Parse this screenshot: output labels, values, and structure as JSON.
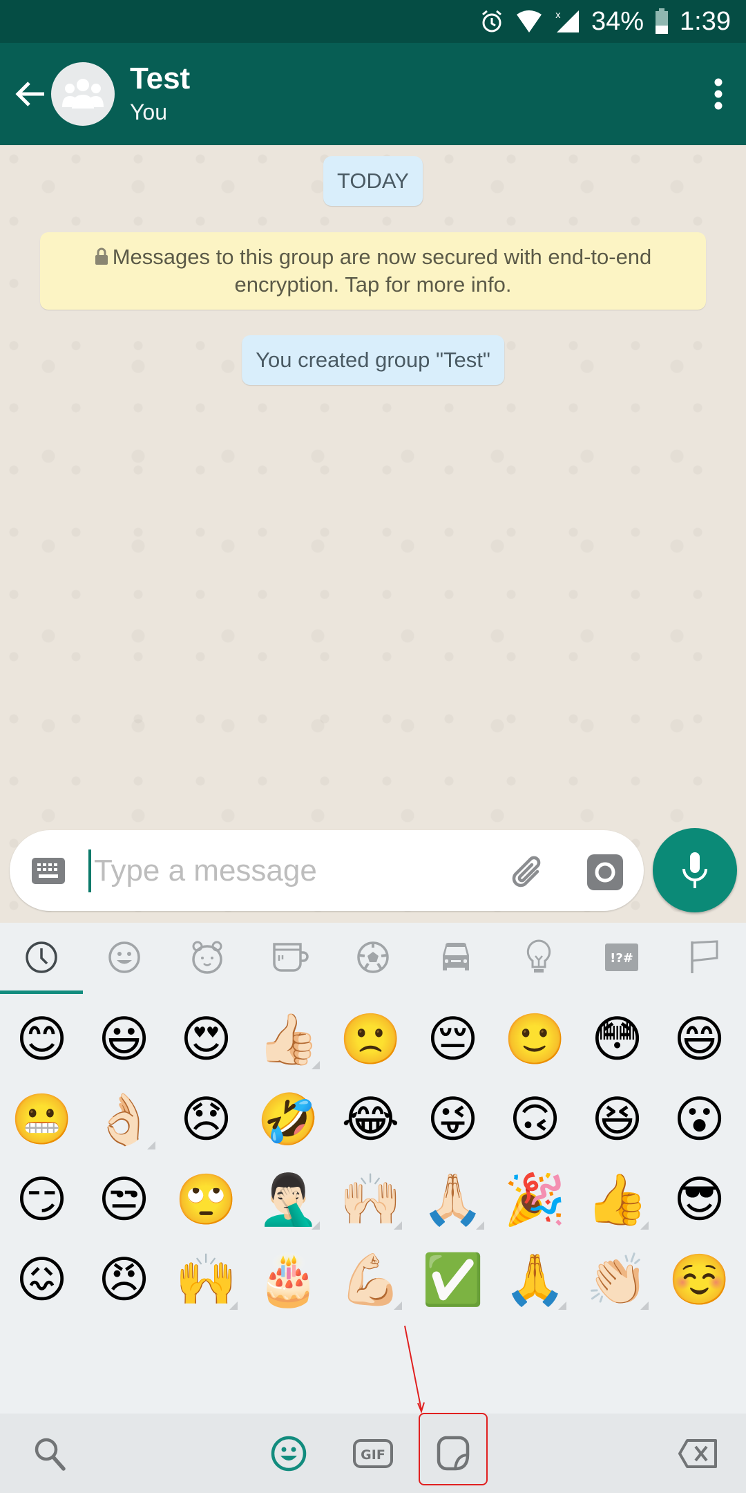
{
  "status_bar": {
    "icons": [
      "alarm-icon",
      "wifi-icon",
      "cell-signal-icon",
      "battery-icon"
    ],
    "battery": "34%",
    "time": "1:39"
  },
  "app_bar": {
    "back_icon": "arrow-left-icon",
    "avatar_icon": "group-icon",
    "title": "Test",
    "subtitle": "You",
    "menu_icon": "more-vertical-icon"
  },
  "chat": {
    "date_chip": "TODAY",
    "encryption_notice": "Messages to this group are now secured with end-to-end encryption. Tap for more info.",
    "system_message": "You created group \"Test\""
  },
  "composer": {
    "keyboard_icon": "keyboard-icon",
    "placeholder": "Type a message",
    "value": "",
    "attach_icon": "paperclip-icon",
    "camera_icon": "camera-icon",
    "mic_icon": "microphone-icon"
  },
  "emoji_panel": {
    "categories": [
      {
        "name": "recent",
        "icon": "clock-icon",
        "active": true
      },
      {
        "name": "smileys",
        "icon": "smiley-icon"
      },
      {
        "name": "animals",
        "icon": "bear-icon"
      },
      {
        "name": "food",
        "icon": "cup-icon"
      },
      {
        "name": "activity",
        "icon": "soccer-ball-icon"
      },
      {
        "name": "travel",
        "icon": "car-icon"
      },
      {
        "name": "objects",
        "icon": "lightbulb-icon"
      },
      {
        "name": "symbols",
        "icon": "symbols-icon",
        "label": "!?#"
      },
      {
        "name": "flags",
        "icon": "flag-icon"
      }
    ],
    "emojis": [
      {
        "char": "😊",
        "name": "smiling-face-with-smiling-eyes"
      },
      {
        "char": "😃",
        "name": "grinning-face-big-eyes"
      },
      {
        "char": "😍",
        "name": "heart-eyes"
      },
      {
        "char": "👍🏻",
        "name": "thumbs-up-light",
        "tone": true
      },
      {
        "char": "🙁",
        "name": "slightly-frowning-face"
      },
      {
        "char": "😔",
        "name": "pensive-face"
      },
      {
        "char": "🙂",
        "name": "slightly-smiling-face"
      },
      {
        "char": "😳",
        "name": "flushed-face"
      },
      {
        "char": "😄",
        "name": "grinning-smiling-eyes"
      },
      {
        "char": "😬",
        "name": "grimacing-face"
      },
      {
        "char": "👌🏻",
        "name": "ok-hand-light",
        "tone": true
      },
      {
        "char": "😞",
        "name": "disappointed-face"
      },
      {
        "char": "🤣",
        "name": "rolling-on-floor-laughing"
      },
      {
        "char": "😂",
        "name": "tears-of-joy"
      },
      {
        "char": "😜",
        "name": "winking-tongue-face"
      },
      {
        "char": "🙃",
        "name": "upside-down-face"
      },
      {
        "char": "😆",
        "name": "grinning-squinting-face"
      },
      {
        "char": "😮",
        "name": "open-mouth-face"
      },
      {
        "char": "😏",
        "name": "smirking-face"
      },
      {
        "char": "😒",
        "name": "unamused-face"
      },
      {
        "char": "🙄",
        "name": "eye-roll-face"
      },
      {
        "char": "🤦🏻‍♂️",
        "name": "facepalm-light",
        "tone": true
      },
      {
        "char": "🙌🏻",
        "name": "raising-hands-light",
        "tone": true
      },
      {
        "char": "🙏🏻",
        "name": "folded-hands-light",
        "tone": true
      },
      {
        "char": "🎉",
        "name": "party-popper"
      },
      {
        "char": "👍",
        "name": "thumbs-up",
        "tone": true
      },
      {
        "char": "😎",
        "name": "sunglasses-face"
      },
      {
        "char": "😖",
        "name": "confounded-face"
      },
      {
        "char": "😠",
        "name": "angry-face"
      },
      {
        "char": "🙌",
        "name": "raising-hands",
        "tone": true
      },
      {
        "char": "🎂",
        "name": "birthday-cake"
      },
      {
        "char": "💪🏻",
        "name": "flexed-biceps-light",
        "tone": true
      },
      {
        "char": "✅",
        "name": "check-mark-button"
      },
      {
        "char": "🙏",
        "name": "folded-hands",
        "tone": true
      },
      {
        "char": "👏🏻",
        "name": "clapping-hands-light",
        "tone": true
      },
      {
        "char": "☺️",
        "name": "smiling-face"
      }
    ]
  },
  "bottom_bar": {
    "items": [
      {
        "name": "search",
        "icon": "search-icon"
      },
      {
        "name": "emoji",
        "icon": "emoji-icon",
        "active": true
      },
      {
        "name": "gif",
        "icon": "gif-icon",
        "label": "GIF"
      },
      {
        "name": "stickers",
        "icon": "sticker-icon",
        "highlighted": true
      },
      {
        "name": "backspace",
        "icon": "backspace-icon"
      }
    ]
  },
  "colors": {
    "primary_dark": "#054d44",
    "primary": "#075e54",
    "accent": "#128c7e",
    "annotation": "#e02020"
  }
}
